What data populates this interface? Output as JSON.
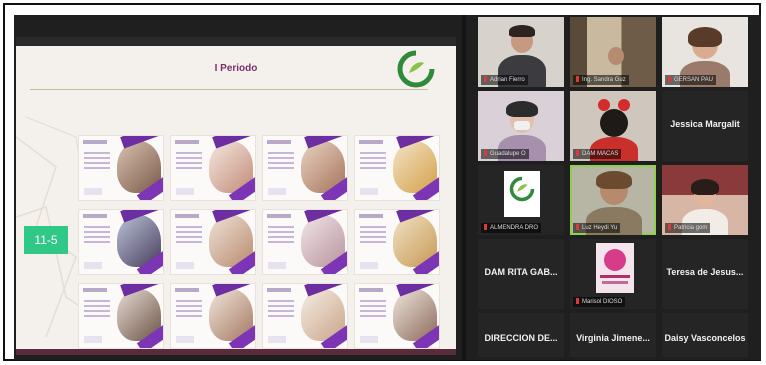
{
  "slide": {
    "title": "I Periodo",
    "grade_label": "11-5",
    "logo_text": ""
  },
  "participants": [
    {
      "name": "Adrian Fierro",
      "type": "video"
    },
    {
      "name": "Ing. Sandra Guz",
      "type": "video"
    },
    {
      "name": "GERSAN PAU",
      "type": "video"
    },
    {
      "name": "Guadalupe O",
      "type": "video"
    },
    {
      "name": "DAM MACAS",
      "type": "video"
    },
    {
      "name": "Jessica Margalit",
      "type": "name"
    },
    {
      "name": "ALMENDRA DRO",
      "type": "logo"
    },
    {
      "name": "Luz Heydi Yu",
      "type": "video",
      "active": true
    },
    {
      "name": "Patricia gom",
      "type": "video"
    },
    {
      "name": "DAM RITA GAB...",
      "type": "name"
    },
    {
      "name": "Marisol DIOSO",
      "type": "avatar"
    },
    {
      "name": "Teresa de Jesus...",
      "type": "name"
    },
    {
      "name": "DIRECCION DE...",
      "type": "name"
    },
    {
      "name": "Virginia Jimene...",
      "type": "name"
    },
    {
      "name": "Daisy Vasconcelos",
      "type": "name"
    }
  ],
  "colors": {
    "accent_green": "#2fc887",
    "slide_title": "#7a2f6b",
    "ribbon_purple": "#6c2ea0",
    "speaker_outline": "#8fd14f"
  }
}
